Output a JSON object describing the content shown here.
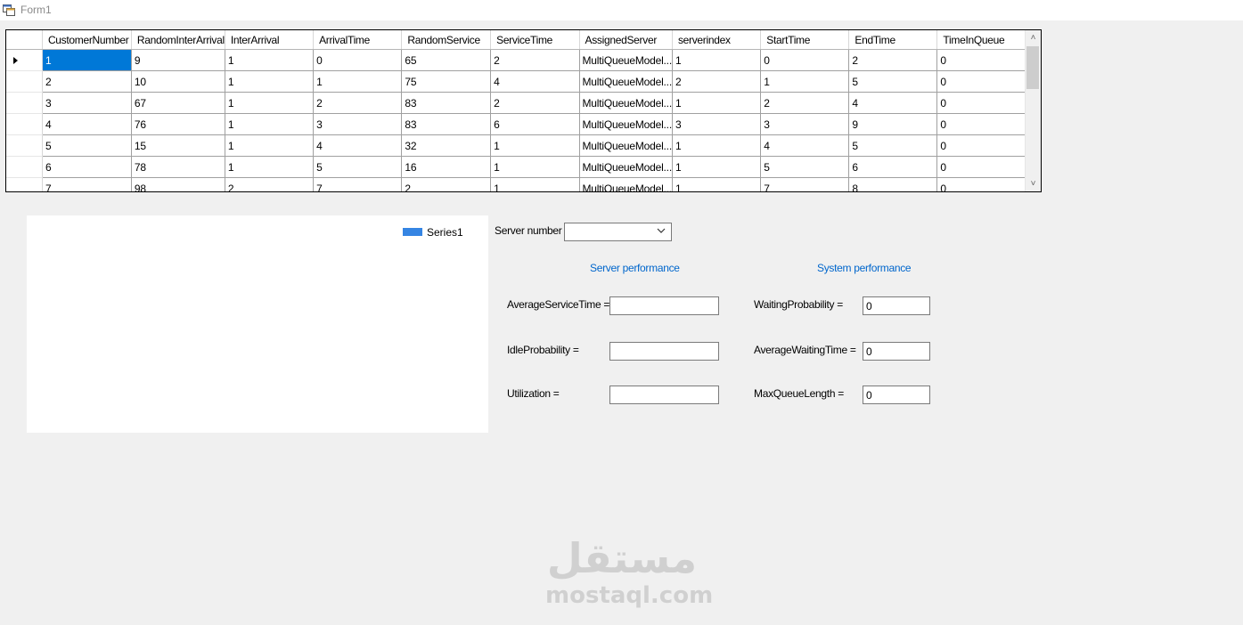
{
  "window": {
    "title": "Form1"
  },
  "grid": {
    "columns": [
      "CustomerNumber",
      "RandomInterArrival",
      "InterArrival",
      "ArrivalTime",
      "RandomService",
      "ServiceTime",
      "AssignedServer",
      "serverindex",
      "StartTime",
      "EndTime",
      "TimeInQueue"
    ],
    "rows": [
      [
        "1",
        "9",
        "1",
        "0",
        "65",
        "2",
        "MultiQueueModel...",
        "1",
        "0",
        "2",
        "0"
      ],
      [
        "2",
        "10",
        "1",
        "1",
        "75",
        "4",
        "MultiQueueModel...",
        "2",
        "1",
        "5",
        "0"
      ],
      [
        "3",
        "67",
        "1",
        "2",
        "83",
        "2",
        "MultiQueueModel...",
        "1",
        "2",
        "4",
        "0"
      ],
      [
        "4",
        "76",
        "1",
        "3",
        "83",
        "6",
        "MultiQueueModel...",
        "3",
        "3",
        "9",
        "0"
      ],
      [
        "5",
        "15",
        "1",
        "4",
        "32",
        "1",
        "MultiQueueModel...",
        "1",
        "4",
        "5",
        "0"
      ],
      [
        "6",
        "78",
        "1",
        "5",
        "16",
        "1",
        "MultiQueueModel...",
        "1",
        "5",
        "6",
        "0"
      ],
      [
        "7",
        "98",
        "2",
        "7",
        "2",
        "1",
        "MultiQueueModel...",
        "1",
        "7",
        "8",
        "0"
      ]
    ]
  },
  "chart": {
    "legend": "Series1",
    "series_color": "#3585e3"
  },
  "server_selector": {
    "label": "Server number",
    "value": ""
  },
  "server_performance": {
    "heading": "Server performance",
    "average_service_time": {
      "label": "AverageServiceTime =",
      "value": ""
    },
    "idle_probability": {
      "label": "IdleProbability =",
      "value": ""
    },
    "utilization": {
      "label": "Utilization =",
      "value": ""
    }
  },
  "system_performance": {
    "heading": "System performance",
    "waiting_probability": {
      "label": "WaitingProbability =",
      "value": "0"
    },
    "average_waiting_time": {
      "label": "AverageWaitingTime =",
      "value": "0"
    },
    "max_queue_length": {
      "label": "MaxQueueLength =",
      "value": "0"
    }
  },
  "watermark": {
    "arabic": "مستقل",
    "latin": "mostaql.com"
  }
}
